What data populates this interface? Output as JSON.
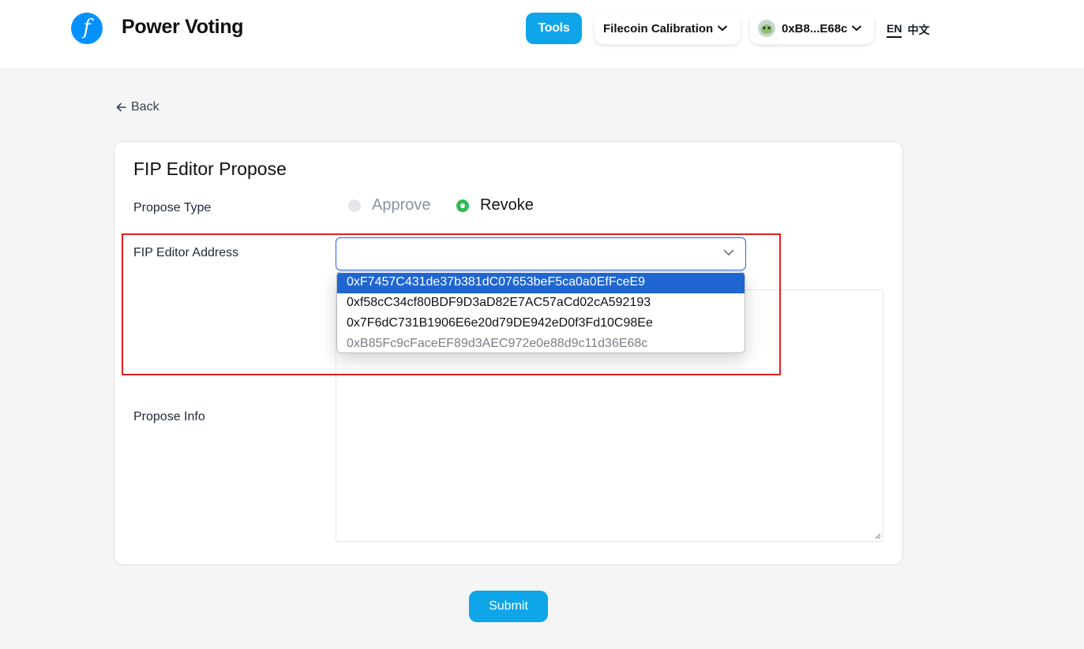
{
  "header": {
    "logo_glyph": "f",
    "brand": "Power Voting",
    "tools_label": "Tools",
    "network_label": "Filecoin Calibration",
    "account_label": "0xB8...E68c",
    "lang_en": "EN",
    "lang_zh": "中文"
  },
  "nav": {
    "back_label": "Back"
  },
  "form": {
    "title": "FIP Editor Propose",
    "propose_type_label": "Propose Type",
    "options": {
      "approve": "Approve",
      "revoke": "Revoke",
      "selected": "revoke"
    },
    "address_label": "FIP Editor Address",
    "address_value": "",
    "address_options": [
      "0xF7457C431de37b381dC07653beF5ca0a0EfFceE9",
      "0xf58cC34cf80BDF9D3aD82E7AC57aCd02cA592193",
      "0x7F6dC731B1906E6e20d79DE942eD0f3Fd10C98Ee",
      "0xB85Fc9cFaceEF89d3AEC972e0e88d9c11d36E68c"
    ],
    "highlighted_option_index": 0,
    "disabled_option_index": 3,
    "info_label": "Propose Info",
    "info_value": "",
    "submit_label": "Submit"
  },
  "colors": {
    "accent": "#0ea5e9",
    "brand_logo": "#0090ff",
    "radio_selected": "#2dbb55",
    "option_highlight": "#1f66d1",
    "annotation_box": "#e02020"
  },
  "icons": [
    "filecoin-logo-icon",
    "chevron-down-icon",
    "avatar-icon",
    "arrow-left-icon",
    "select-caret-icon"
  ]
}
